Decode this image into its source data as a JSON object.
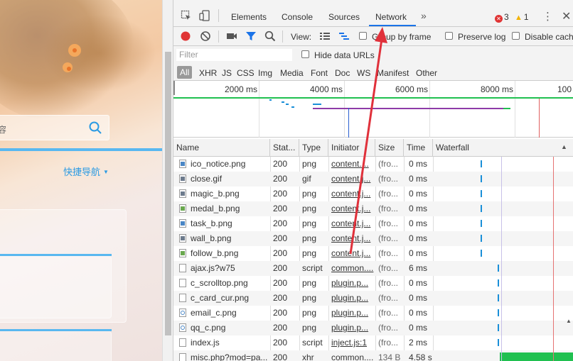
{
  "page": {
    "search_placeholder": "容",
    "quick_nav": "快捷导航"
  },
  "devtools": {
    "tabs": [
      "Elements",
      "Console",
      "Sources",
      "Network"
    ],
    "active_tab": "Network",
    "errors": "3",
    "warnings": "1",
    "toolbar": {
      "view_label": "View:",
      "group_by_frame": "Group by frame",
      "preserve_log": "Preserve log",
      "disable_cache": "Disable cache"
    },
    "filter_placeholder": "Filter",
    "hide_data_urls": "Hide data URLs",
    "type_filters": [
      "All",
      "XHR",
      "JS",
      "CSS",
      "Img",
      "Media",
      "Font",
      "Doc",
      "WS",
      "Manifest",
      "Other"
    ],
    "overview_ticks": [
      "2000 ms",
      "4000 ms",
      "6000 ms",
      "8000 ms",
      "100"
    ],
    "columns": [
      "Name",
      "Stat...",
      "Type",
      "Initiator",
      "Size",
      "Time",
      "Waterfall"
    ],
    "rows": [
      {
        "name": "ico_notice.png",
        "status": "200",
        "type": "png",
        "initiator": "content....",
        "size": "(fro...",
        "time": "0 ms",
        "icon": "img"
      },
      {
        "name": "close.gif",
        "status": "200",
        "type": "gif",
        "initiator": "content.j...",
        "size": "(fro...",
        "time": "0 ms",
        "icon": "img-d"
      },
      {
        "name": "magic_b.png",
        "status": "200",
        "type": "png",
        "initiator": "content.j...",
        "size": "(fro...",
        "time": "0 ms",
        "icon": "img-d"
      },
      {
        "name": "medal_b.png",
        "status": "200",
        "type": "png",
        "initiator": "content.j...",
        "size": "(fro...",
        "time": "0 ms",
        "icon": "img-g"
      },
      {
        "name": "task_b.png",
        "status": "200",
        "type": "png",
        "initiator": "content.j...",
        "size": "(fro...",
        "time": "0 ms",
        "icon": "img"
      },
      {
        "name": "wall_b.png",
        "status": "200",
        "type": "png",
        "initiator": "content.j...",
        "size": "(fro...",
        "time": "0 ms",
        "icon": "img-d"
      },
      {
        "name": "follow_b.png",
        "status": "200",
        "type": "png",
        "initiator": "content.j...",
        "size": "(fro...",
        "time": "0 ms",
        "icon": "img-g"
      },
      {
        "name": "ajax.js?w75",
        "status": "200",
        "type": "script",
        "initiator": "common....",
        "size": "(fro...",
        "time": "6 ms",
        "icon": "doc"
      },
      {
        "name": "c_scrolltop.png",
        "status": "200",
        "type": "png",
        "initiator": "plugin.p...",
        "size": "(fro...",
        "time": "0 ms",
        "icon": "doc"
      },
      {
        "name": "c_card_cur.png",
        "status": "200",
        "type": "png",
        "initiator": "plugin.p...",
        "size": "(fro...",
        "time": "0 ms",
        "icon": "doc"
      },
      {
        "name": "email_c.png",
        "status": "200",
        "type": "png",
        "initiator": "plugin.p...",
        "size": "(fro...",
        "time": "0 ms",
        "icon": "circ"
      },
      {
        "name": "qq_c.png",
        "status": "200",
        "type": "png",
        "initiator": "plugin.p...",
        "size": "(fro...",
        "time": "0 ms",
        "icon": "circ"
      },
      {
        "name": "index.js",
        "status": "200",
        "type": "script",
        "initiator": "inject.js:1",
        "size": "(fro...",
        "time": "2 ms",
        "icon": "doc"
      },
      {
        "name": "misc.php?mod=pa...",
        "status": "200",
        "type": "xhr",
        "initiator": "common....",
        "size": "134 B",
        "time": "4.58 s",
        "icon": "doc"
      }
    ],
    "colors": {
      "accent": "#1a73e8",
      "record": "#e03434",
      "waterfall_bar": "#1a8fd8",
      "long_bar": "#20c050"
    }
  }
}
